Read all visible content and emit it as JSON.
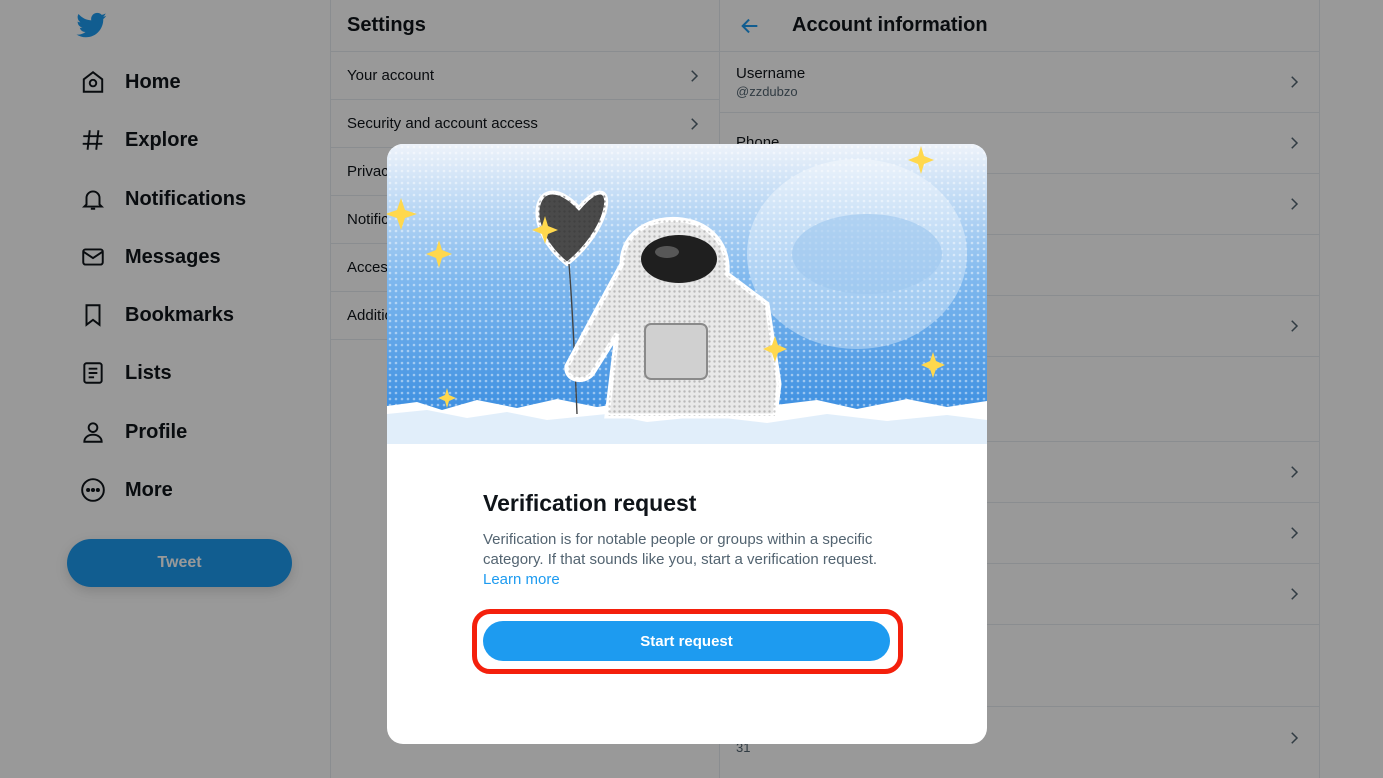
{
  "nav": {
    "items": [
      {
        "label": "Home",
        "icon": "home-icon"
      },
      {
        "label": "Explore",
        "icon": "hashtag-icon"
      },
      {
        "label": "Notifications",
        "icon": "bell-icon"
      },
      {
        "label": "Messages",
        "icon": "envelope-icon"
      },
      {
        "label": "Bookmarks",
        "icon": "bookmark-icon"
      },
      {
        "label": "Lists",
        "icon": "list-icon"
      },
      {
        "label": "Profile",
        "icon": "person-icon"
      },
      {
        "label": "More",
        "icon": "more-circle-icon"
      }
    ],
    "tweet_label": "Tweet"
  },
  "settings": {
    "title": "Settings",
    "items": [
      {
        "label": "Your account"
      },
      {
        "label": "Security and account access"
      },
      {
        "label": "Privacy and safety"
      },
      {
        "label": "Notifications"
      },
      {
        "label": "Accessibility, display, and languages"
      },
      {
        "label": "Additional resources"
      }
    ]
  },
  "account": {
    "title": "Account information",
    "rows": [
      {
        "key": "Username",
        "value": "@zzdubzo"
      },
      {
        "key": "Phone",
        "value": ""
      },
      {
        "key": "",
        "value": "31"
      }
    ]
  },
  "modal": {
    "title": "Verification request",
    "body": "Verification is for notable people or groups within a specific category. If that sounds like you, start a verification request.",
    "learn_more": "Learn more",
    "button_label": "Start request"
  },
  "colors": {
    "accent": "#1d9bf0",
    "highlight": "#f4200c"
  }
}
